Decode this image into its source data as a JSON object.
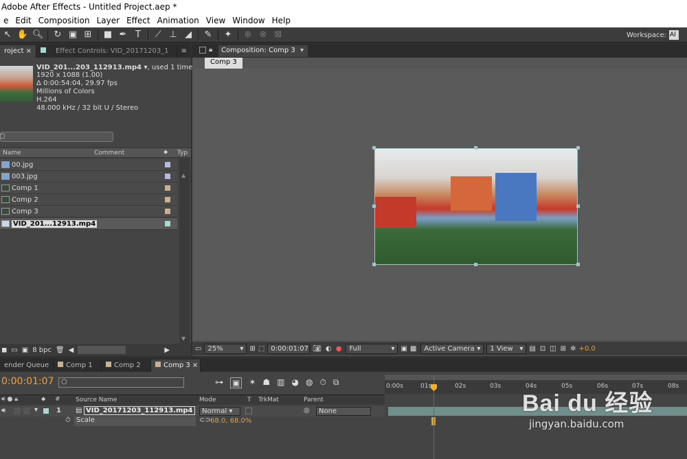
{
  "window": {
    "title": "Adobe After Effects - Untitled Project.aep *"
  },
  "menu": [
    "e",
    "Edit",
    "Composition",
    "Layer",
    "Effect",
    "Animation",
    "View",
    "Window",
    "Help"
  ],
  "workspace": {
    "label": "Workspace:",
    "value": "Al"
  },
  "project": {
    "tab_project": "roject",
    "tab_effect_controls": "Effect Controls: VID_20171203_1",
    "footage": {
      "name": "VID_201...203_112913.mp4",
      "used": ", used 1 time",
      "dims": "1920 x 1088 (1.00)",
      "duration": "Δ 0:00:54:04, 29.97 fps",
      "colors": "Millions of Colors",
      "codec": "H.264",
      "audio": "48.000 kHz / 32 bit U / Stereo"
    },
    "columns": {
      "name": "Name",
      "comment": "Comment",
      "type": "Typ"
    },
    "items": [
      {
        "name": "00.jpg",
        "color": "#b8b8e0",
        "kind": "image"
      },
      {
        "name": "003.jpg",
        "color": "#b8b8e0",
        "kind": "image"
      },
      {
        "name": "Comp 1",
        "color": "#c8b090",
        "kind": "comp"
      },
      {
        "name": "Comp 2",
        "color": "#c8b090",
        "kind": "comp"
      },
      {
        "name": "Comp 3",
        "color": "#c8b090",
        "kind": "comp"
      },
      {
        "name": "VID_201...12913.mp4",
        "color": "#a8d8d0",
        "kind": "video"
      }
    ],
    "bpc": "8 bpc"
  },
  "composition": {
    "tab": "Composition: Comp 3",
    "label": "Comp 3",
    "zoom": "25%",
    "timecode": "0:00:01:07",
    "resolution": "Full",
    "camera": "Active Camera",
    "views": "1 View",
    "exposure": "+0.0"
  },
  "timeline": {
    "tabs": [
      "ender Queue",
      "Comp 1",
      "Comp 2",
      "Comp 3"
    ],
    "timecode": "0:00:01:07",
    "ruler": [
      "0:00s",
      "01s",
      "02s",
      "03s",
      "04s",
      "05s",
      "06s",
      "07s",
      "08s"
    ],
    "headers": {
      "source": "Source Name",
      "mode": "Mode",
      "t": "T",
      "trkmat": "TrkMat",
      "parent": "Parent"
    },
    "layer": {
      "num": "1",
      "name": "VID_20171203_112913.mp4",
      "mode": "Normal",
      "parent": "None"
    },
    "property": {
      "name": "Scale",
      "value": "68.0, 68.0%"
    }
  },
  "watermark": {
    "brand": "Bai du 经验",
    "url": "jingyan.baidu.com"
  }
}
